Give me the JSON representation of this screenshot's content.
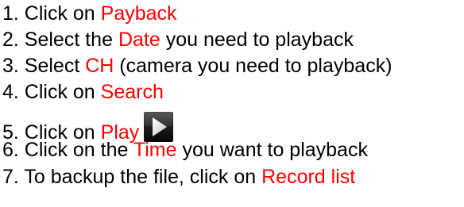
{
  "colors": {
    "text": "#000000",
    "highlight": "#ff0000",
    "background": "#ffffff"
  },
  "steps": [
    {
      "prefix": "1. Click on ",
      "highlight": "Payback",
      "suffix": ""
    },
    {
      "prefix": "2. Select the ",
      "highlight": "Date",
      "suffix": " you need to playback"
    },
    {
      "prefix": "3. Select ",
      "highlight": "CH",
      "suffix": " (camera you need to playback)"
    },
    {
      "prefix": "4. Click on ",
      "highlight": "Search",
      "suffix": ""
    },
    {
      "prefix": "5. Click on ",
      "highlight": "Play",
      "suffix": "",
      "icon": "play-button-icon"
    },
    {
      "prefix": "6. Click on the ",
      "highlight": "Time",
      "suffix": " you want to playback"
    },
    {
      "prefix": "7. To backup the file, click on ",
      "highlight": "Record list",
      "suffix": ""
    }
  ]
}
